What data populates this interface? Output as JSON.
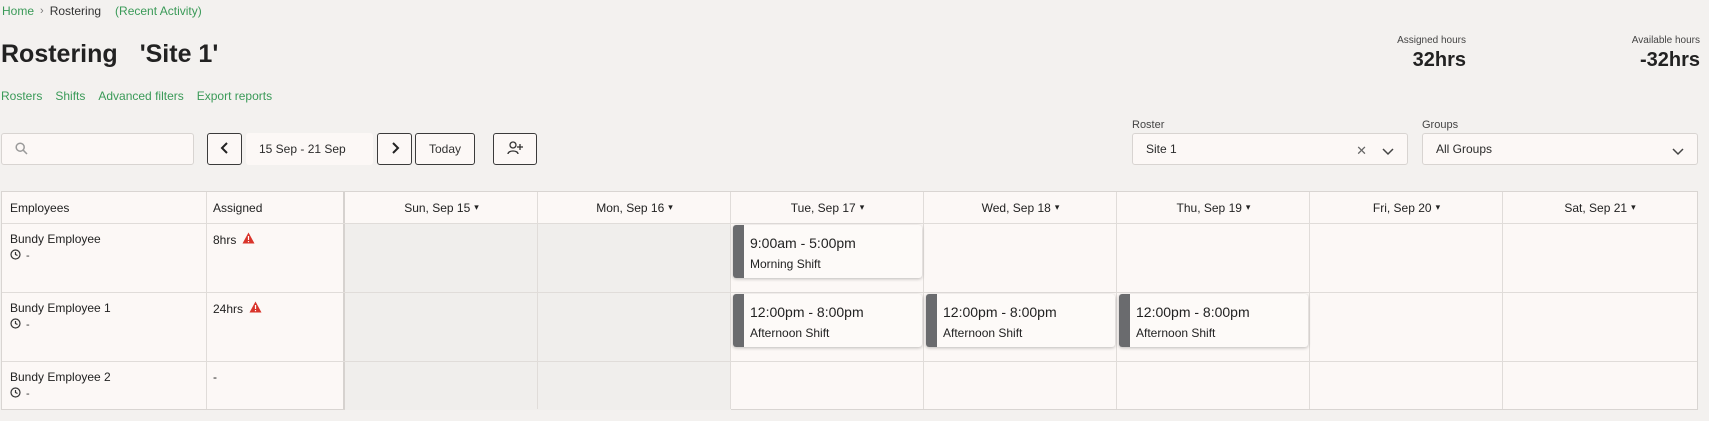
{
  "breadcrumb": {
    "home": "Home",
    "sep": "›",
    "current": "Rostering",
    "recent": "(Recent Activity)"
  },
  "title": {
    "main": "Rostering",
    "site": "'Site 1'"
  },
  "subnav": [
    "Rosters",
    "Shifts",
    "Advanced filters",
    "Export reports"
  ],
  "stats": {
    "assigned": {
      "label": "Assigned hours",
      "value": "32hrs"
    },
    "available": {
      "label": "Available hours",
      "value": "-32hrs"
    }
  },
  "search": {
    "placeholder": ""
  },
  "toolbar": {
    "date_range": "15 Sep - 21 Sep",
    "today_label": "Today"
  },
  "roster": {
    "label": "Roster",
    "value": "Site 1"
  },
  "groups": {
    "label": "Groups",
    "value": "All Groups"
  },
  "table": {
    "headers": {
      "employees": "Employees",
      "assigned": "Assigned"
    },
    "days": [
      "Sun, Sep 15",
      "Mon, Sep 16",
      "Tue, Sep 17",
      "Wed, Sep 18",
      "Thu, Sep 19",
      "Fri, Sep 20",
      "Sat, Sep 21"
    ],
    "employees": [
      {
        "name": "Bundy Employee",
        "clock": "-",
        "assigned": "8hrs",
        "warning": true
      },
      {
        "name": "Bundy Employee 1",
        "clock": "-",
        "assigned": "24hrs",
        "warning": true
      },
      {
        "name": "Bundy Employee 2",
        "clock": "-",
        "assigned": "-",
        "warning": false
      }
    ],
    "shifts": [
      {
        "time": "9:00am - 5:00pm",
        "name": "Morning Shift"
      },
      {
        "time": "12:00pm - 8:00pm",
        "name": "Afternoon Shift"
      },
      {
        "time": "12:00pm - 8:00pm",
        "name": "Afternoon Shift"
      },
      {
        "time": "12:00pm - 8:00pm",
        "name": "Afternoon Shift"
      }
    ]
  },
  "colors": {
    "accent": "#3a9a58",
    "shift_bar": "#6a6b6e",
    "warning": "#d9342b"
  }
}
